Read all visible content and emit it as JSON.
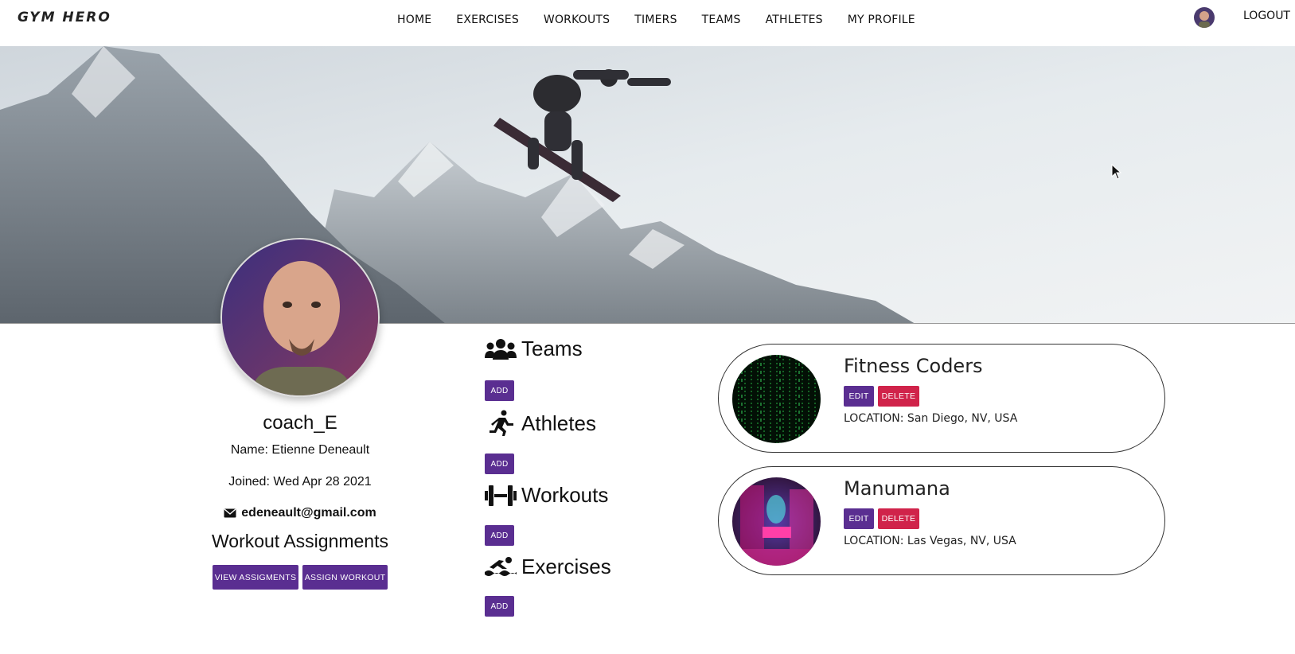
{
  "navbar": {
    "brand": "GYM HERO",
    "links": [
      "HOME",
      "EXERCISES",
      "WORKOUTS",
      "TIMERS",
      "TEAMS",
      "ATHLETES",
      "MY PROFILE"
    ],
    "logout": "LOGOUT"
  },
  "profile": {
    "username": "coach_E",
    "name_line": "Name: Etienne Deneault",
    "joined_line": "Joined: Wed Apr 28 2021",
    "email": "edeneault@gmail.com",
    "assignments_title": "Workout Assignments",
    "view_button": "VIEW ASSIGMENTS",
    "assign_button": "ASSIGN WORKOUT"
  },
  "sections": [
    {
      "title": "Teams",
      "icon": "users-icon",
      "add_label": "ADD"
    },
    {
      "title": "Athletes",
      "icon": "running-icon",
      "add_label": "ADD"
    },
    {
      "title": "Workouts",
      "icon": "dumbbell-icon",
      "add_label": "ADD"
    },
    {
      "title": "Exercises",
      "icon": "swimmer-icon",
      "add_label": "ADD"
    }
  ],
  "teams": [
    {
      "name": "Fitness Coders",
      "edit_label": "EDIT",
      "delete_label": "DELETE",
      "location": "LOCATION: San Diego, NV, USA",
      "logo": "matrix-code-image"
    },
    {
      "name": "Manumana",
      "edit_label": "EDIT",
      "delete_label": "DELETE",
      "location": "LOCATION: Las Vegas, NV, USA",
      "logo": "circus-neon-image"
    }
  ],
  "colors": {
    "primary_button": "#5a2e91",
    "danger_button": "#d0234a"
  }
}
